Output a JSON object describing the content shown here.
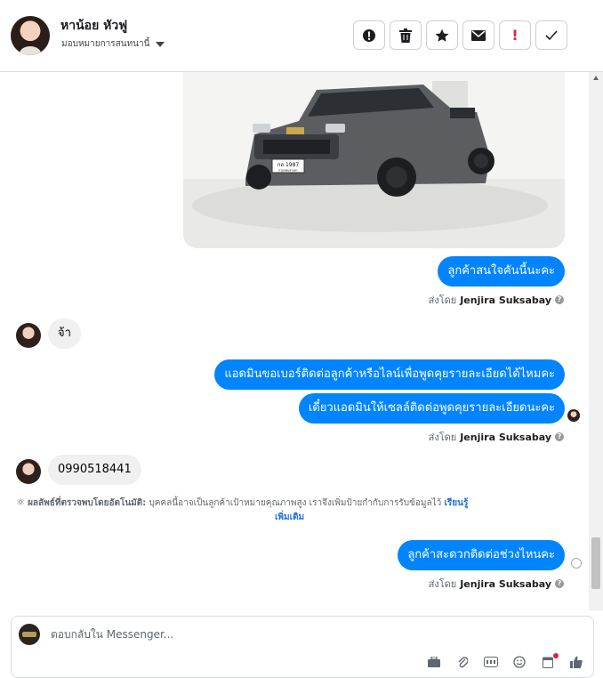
{
  "contact": {
    "name": "หาน้อย หัวฟู",
    "assign_label": "มอบหมายการสนทนานี้"
  },
  "actions": [
    {
      "name": "mark-spam-button",
      "icon": "alert-icon",
      "glyph": "!"
    },
    {
      "name": "delete-button",
      "icon": "trash-icon"
    },
    {
      "name": "star-button",
      "icon": "star-icon",
      "glyph": "★"
    },
    {
      "name": "mark-unread-button",
      "icon": "envelope-icon"
    },
    {
      "name": "follow-up-button",
      "icon": "exclamation-icon",
      "glyph": "!"
    },
    {
      "name": "mark-done-button",
      "icon": "checkmark-icon",
      "glyph": "✓"
    }
  ],
  "messages": {
    "m1": "ลูกค้าสนใจคันนี้นะคะ",
    "m2": "จ้า",
    "m3": "แอดมินขอเบอร์ติดต่อลูกค้าหรือไลน์เพื่อพูดคุยรายละเอียดได้ไหมคะ",
    "m4": "เดี๋ยวแอดมินให้เซลล์ติดต่อพูดคุยรายละเอียดนะคะ",
    "m5": "0990518441",
    "m6": "ลูกค้าสะดวกติดต่อช่วงไหนคะ"
  },
  "sent_by": {
    "prefix": "ส่งโดย",
    "name": "Jenjira Suksabay",
    "info_glyph": "?"
  },
  "ai_note": {
    "title": "ผลลัพธ์ที่ตรวจพบโดยอัตโนมัติ:",
    "text": "บุคคลนี้อาจเป็นลูกค้าเป้าหมายคุณภาพสูง เราจึงเพิ่มป้ายกำกับการรับข้อมูลไว้",
    "link1": "เรียนรู้",
    "link2": "เพิ่มเติม"
  },
  "car_image": {
    "plate_top": "กล 1987",
    "plate_bottom": "กรุงเทพมหานคร"
  },
  "composer": {
    "placeholder": "ตอบกลับใน Messenger..."
  },
  "colors": {
    "accent": "#0084ff",
    "bubble_in": "#f0f0f0",
    "red_badge": "#e41e3f"
  }
}
